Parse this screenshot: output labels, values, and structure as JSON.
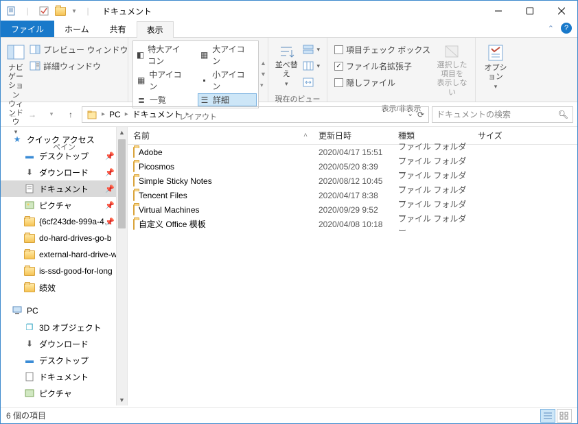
{
  "window": {
    "title": "ドキュメント"
  },
  "tabs": {
    "file": "ファイル",
    "home": "ホーム",
    "share": "共有",
    "view": "表示"
  },
  "ribbon": {
    "pane": {
      "nav": "ナビゲーション\nウィンドウ",
      "preview": "プレビュー ウィンドウ",
      "details": "詳細ウィンドウ",
      "label": "ペイン"
    },
    "layout": {
      "xl": "特大アイコン",
      "l": "大アイコン",
      "m": "中アイコン",
      "s": "小アイコン",
      "list": "一覧",
      "detail": "詳細",
      "label": "レイアウト"
    },
    "currentview": {
      "sort": "並べ替え",
      "label": "現在のビュー"
    },
    "showhide": {
      "checkboxes": "項目チェック ボックス",
      "ext": "ファイル名拡張子",
      "hidden": "隠しファイル",
      "hidesel": "選択した項目を\n表示しない",
      "label": "表示/非表示"
    },
    "options": {
      "label": "オプション"
    }
  },
  "address": {
    "pc": "PC",
    "docs": "ドキュメント"
  },
  "search": {
    "placeholder": "ドキュメントの検索"
  },
  "columns": {
    "name": "名前",
    "date": "更新日時",
    "type": "種類",
    "size": "サイズ"
  },
  "items": [
    {
      "name": "Adobe",
      "date": "2020/04/17 15:51",
      "type": "ファイル フォルダー"
    },
    {
      "name": "Picosmos",
      "date": "2020/05/20 8:39",
      "type": "ファイル フォルダー"
    },
    {
      "name": "Simple Sticky Notes",
      "date": "2020/08/12 10:45",
      "type": "ファイル フォルダー"
    },
    {
      "name": "Tencent Files",
      "date": "2020/04/17 8:38",
      "type": "ファイル フォルダー"
    },
    {
      "name": "Virtual Machines",
      "date": "2020/09/29 9:52",
      "type": "ファイル フォルダー"
    },
    {
      "name": "自定义 Office 模板",
      "date": "2020/04/08 10:18",
      "type": "ファイル フォルダー"
    }
  ],
  "tree": {
    "quick": "クイック アクセス",
    "desktop": "デスクトップ",
    "downloads": "ダウンロード",
    "documents": "ドキュメント",
    "pictures": "ピクチャ",
    "f1": "{6cf243de-999a-4…",
    "f2": "do-hard-drives-go-b",
    "f3": "external-hard-drive-w",
    "f4": "is-ssd-good-for-long",
    "f5": "绩效",
    "pc": "PC",
    "obj3d": "3D オブジェクト",
    "downloads2": "ダウンロード",
    "desktop2": "デスクトップ",
    "documents2": "ドキュメント",
    "pictures2": "ピクチャ"
  },
  "status": {
    "count": "6 個の項目"
  }
}
